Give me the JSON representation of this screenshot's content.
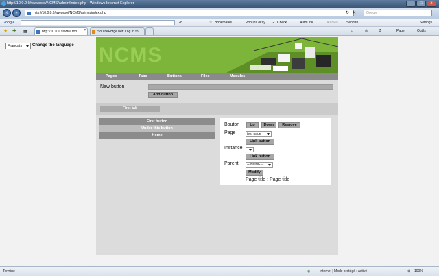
{
  "window": {
    "title": "http://10.0.0.9/wwwroot/NCMS/admin/index.php - Windows Internet Explorer",
    "controls": [
      "_",
      "□",
      "x"
    ]
  },
  "address_bar": {
    "url": "http://10.0.0.9/wwwroot/NCMS/admin/index.php",
    "search_placeholder": "Google"
  },
  "toolbar": {
    "google_label": "Google",
    "go_label": "Go",
    "bookmarks_label": "Bookmarks",
    "popups_label": "Popups okay",
    "check_label": "Check",
    "autolink_label": "AutoLink",
    "autofill_label": "AutoFill",
    "sendto_label": "Send to",
    "settings_label": "Settings"
  },
  "tabs": [
    {
      "label": "http://10.0.0.9/www.roo..."
    },
    {
      "label": "SourceForge.net: Log In to..."
    }
  ],
  "command_bar": {
    "page_label": "Page",
    "tools_label": "Outils"
  },
  "page": {
    "language_select": "Français",
    "language_label": "Change the language",
    "logo": "NCMS",
    "nav": [
      "Pages",
      "Tabs",
      "Buttons",
      "Files",
      "Modules"
    ],
    "new_button_label": "New button",
    "add_button_label": "Add button",
    "first_tab_label": "First tab",
    "left_list": [
      {
        "label": "First button"
      },
      {
        "label": "Under this button"
      },
      {
        "label": "Home"
      }
    ],
    "panel": {
      "bouton_label": "Bouton",
      "up_label": "Up",
      "down_label": "Down",
      "remove_label": "Remove",
      "page_label": "Page",
      "page_select": "test page",
      "link_button_label": "Link button",
      "instance_label": "Instance",
      "parent_label": "Parent",
      "parent_select": "---NONE---",
      "modify_label": "Modify",
      "page_title_text": "Page title : Page title"
    }
  },
  "status_bar": {
    "left_text": "Terminé",
    "zone_text": "Internet | Mode protégé : activé",
    "zoom_text": "100%"
  }
}
